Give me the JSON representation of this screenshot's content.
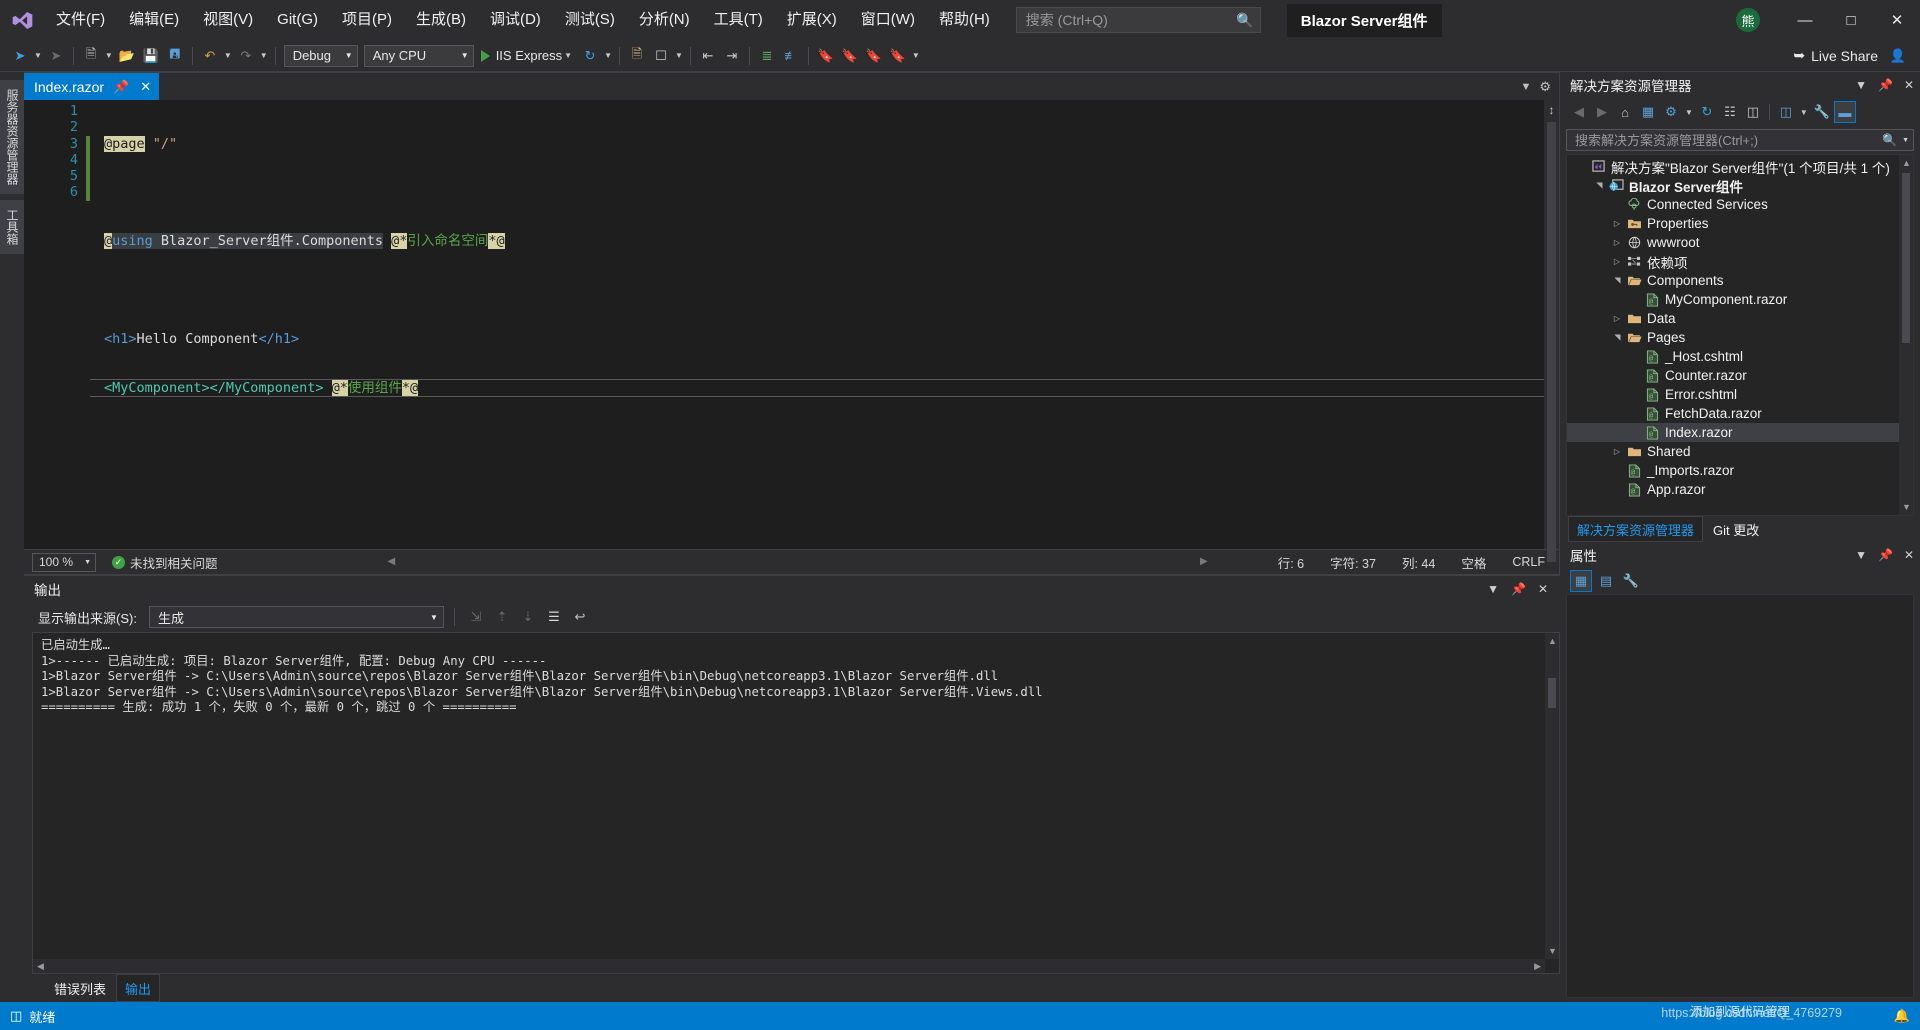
{
  "window": {
    "project_chip": "Blazor Server组件",
    "account_initial": "熊",
    "minimize": "—",
    "maximize": "□",
    "close": "✕"
  },
  "menu": {
    "items": [
      {
        "label": "文件(F)"
      },
      {
        "label": "编辑(E)"
      },
      {
        "label": "视图(V)"
      },
      {
        "label": "Git(G)"
      },
      {
        "label": "项目(P)"
      },
      {
        "label": "生成(B)"
      },
      {
        "label": "调试(D)"
      },
      {
        "label": "测试(S)"
      },
      {
        "label": "分析(N)"
      },
      {
        "label": "工具(T)"
      },
      {
        "label": "扩展(X)"
      },
      {
        "label": "窗口(W)"
      },
      {
        "label": "帮助(H)"
      }
    ]
  },
  "search": {
    "placeholder": "搜索 (Ctrl+Q)",
    "value": ""
  },
  "toolbar": {
    "config": "Debug",
    "platform": "Any CPU",
    "run_target": "IIS Express",
    "live_share": "Live Share"
  },
  "left_dock": {
    "tabs": [
      "服务器资源管理器",
      "工具箱"
    ]
  },
  "editor": {
    "tab_name": "Index.razor",
    "lines": [
      {
        "no": "1",
        "modified": false
      },
      {
        "no": "2",
        "modified": false
      },
      {
        "no": "3",
        "modified": true
      },
      {
        "no": "4",
        "modified": true
      },
      {
        "no": "5",
        "modified": true
      },
      {
        "no": "6",
        "modified": true
      }
    ],
    "code": {
      "l1_at": "@page",
      "l1_str": "\"/\"",
      "l3_at": "@",
      "l3_using": "using",
      "l3_ns": " Blazor_Server组件.Components",
      "l3_cmt_open": "@*",
      "l3_cmt": "引入命名空间",
      "l3_cmt_close": "*@",
      "l5": "<h1>Hello Component</h1>",
      "l5_open": "<h1>",
      "l5_text": "Hello Component",
      "l5_close": "</h1>",
      "l6_open": "<MyComponent>",
      "l6_close": "</MyComponent>",
      "l6_cmt_open": "@*",
      "l6_cmt": "使用组件",
      "l6_cmt_close": "*@"
    },
    "status": {
      "zoom": "100 %",
      "issues": "未找到相关问题",
      "line": "行: 6",
      "chars": "字符: 37",
      "column": "列: 44",
      "indent": "空格",
      "eol": "CRLF"
    }
  },
  "output": {
    "title": "输出",
    "source_label": "显示输出来源(S):",
    "source_value": "生成",
    "lines": [
      "已启动生成…",
      "1>------ 已启动生成: 项目: Blazor Server组件, 配置: Debug Any CPU ------",
      "1>Blazor Server组件 -> C:\\Users\\Admin\\source\\repos\\Blazor Server组件\\Blazor Server组件\\bin\\Debug\\netcoreapp3.1\\Blazor Server组件.dll",
      "1>Blazor Server组件 -> C:\\Users\\Admin\\source\\repos\\Blazor Server组件\\Blazor Server组件\\bin\\Debug\\netcoreapp3.1\\Blazor Server组件.Views.dll",
      "========== 生成: 成功 1 个，失败 0 个，最新 0 个，跳过 0 个 =========="
    ],
    "tabs": [
      {
        "label": "错误列表",
        "active": false
      },
      {
        "label": "输出",
        "active": true
      }
    ]
  },
  "solution_explorer": {
    "title": "解决方案资源管理器",
    "search_placeholder": "搜索解决方案资源管理器(Ctrl+;)",
    "tree": [
      {
        "label": "解决方案\"Blazor Server组件\"(1 个项目/共 1 个)",
        "indent": 0,
        "icon": "solution",
        "expander": "",
        "bold": false,
        "selected": false
      },
      {
        "label": "Blazor Server组件",
        "indent": 1,
        "icon": "project",
        "expander": "expanded",
        "bold": true,
        "selected": false
      },
      {
        "label": "Connected Services",
        "indent": 2,
        "icon": "services",
        "expander": "",
        "bold": false,
        "selected": false
      },
      {
        "label": "Properties",
        "indent": 2,
        "icon": "folder-props",
        "expander": "collapsed",
        "bold": false,
        "selected": false
      },
      {
        "label": "wwwroot",
        "indent": 2,
        "icon": "globe",
        "expander": "collapsed",
        "bold": false,
        "selected": false
      },
      {
        "label": "依赖项",
        "indent": 2,
        "icon": "deps",
        "expander": "collapsed",
        "bold": false,
        "selected": false
      },
      {
        "label": "Components",
        "indent": 2,
        "icon": "folder-open",
        "expander": "expanded",
        "bold": false,
        "selected": false
      },
      {
        "label": "MyComponent.razor",
        "indent": 3,
        "icon": "razor",
        "expander": "",
        "bold": false,
        "selected": false
      },
      {
        "label": "Data",
        "indent": 2,
        "icon": "folder",
        "expander": "collapsed",
        "bold": false,
        "selected": false
      },
      {
        "label": "Pages",
        "indent": 2,
        "icon": "folder-open",
        "expander": "expanded",
        "bold": false,
        "selected": false
      },
      {
        "label": "_Host.cshtml",
        "indent": 3,
        "icon": "razor",
        "expander": "",
        "bold": false,
        "selected": false
      },
      {
        "label": "Counter.razor",
        "indent": 3,
        "icon": "razor",
        "expander": "",
        "bold": false,
        "selected": false
      },
      {
        "label": "Error.cshtml",
        "indent": 3,
        "icon": "razor",
        "expander": "",
        "bold": false,
        "selected": false
      },
      {
        "label": "FetchData.razor",
        "indent": 3,
        "icon": "razor",
        "expander": "",
        "bold": false,
        "selected": false
      },
      {
        "label": "Index.razor",
        "indent": 3,
        "icon": "razor",
        "expander": "",
        "bold": false,
        "selected": true
      },
      {
        "label": "Shared",
        "indent": 2,
        "icon": "folder",
        "expander": "collapsed",
        "bold": false,
        "selected": false
      },
      {
        "label": "_Imports.razor",
        "indent": 2,
        "icon": "razor",
        "expander": "",
        "bold": false,
        "selected": false
      },
      {
        "label": "App.razor",
        "indent": 2,
        "icon": "razor",
        "expander": "",
        "bold": false,
        "selected": false
      }
    ],
    "tabs": [
      {
        "label": "解决方案资源管理器",
        "active": true
      },
      {
        "label": "Git 更改",
        "active": false
      }
    ]
  },
  "properties": {
    "title": "属性"
  },
  "statusbar": {
    "ready": "就绪",
    "watermark": "https://blog.csdn.net/Q_4769279",
    "watermark_overlay": "添加到源代码管理"
  },
  "colors": {
    "accent": "#007acc",
    "chrome": "#2d2d30",
    "editor_bg": "#1e1e1e",
    "panel_bg": "#252526",
    "selected_row": "#3f3f46",
    "green_ok": "#3fa346",
    "comment_green": "#57a64a",
    "keyword_blue": "#569cd6",
    "string_orange": "#d69d85",
    "razor_at_bg": "#d7d2a8"
  }
}
